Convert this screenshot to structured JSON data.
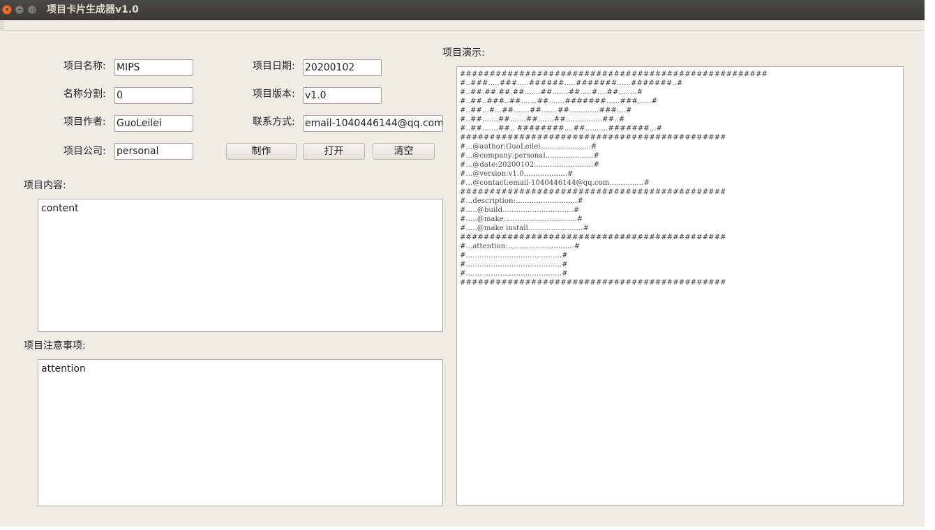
{
  "window": {
    "title": "项目卡片生成器v1.0",
    "controls": {
      "close": "×",
      "minimize": "–",
      "maximize": "▫"
    }
  },
  "form": {
    "name_label": "项目名称:",
    "name_value": "MIPS",
    "date_label": "项目日期:",
    "date_value": "20200102",
    "split_label": "名称分割:",
    "split_value": "0",
    "version_label": "项目版本:",
    "version_value": "v1.0",
    "author_label": "项目作者:",
    "author_value": "GuoLeilei",
    "contact_label": "联系方式:",
    "contact_value": "email-1040446144@qq.com",
    "company_label": "项目公司:",
    "company_value": "personal",
    "make_button": "制作",
    "open_button": "打开",
    "clear_button": "清空",
    "content_label": "项目内容:",
    "content_value": "content",
    "attention_label": "项目注意事项:",
    "attention_value": "attention"
  },
  "preview": {
    "label": "项目演示:",
    "text": "####################################################\n#..###.....###.....######.....#######......#######..#\n#..##.##.##.##.......##.......##.....#....##........#\n#..##..###..##.......##.......#######......###......#\n#..##...#...##.......##.......##.............###....#\n#..##.......##.......##.......##................##..#\n#..##.......##.. ########....##..........#######...#\n#############################################\n#...@author:GuoLeilei......................#\n#...@company:personal.....................#\n#...@date:20200102..........................#\n#...@version:v1.0...................#\n#...@contact:email-1040446144@qq.com...............#\n#############################################\n#...description:...........................#\n#.....@build...............................#\n#.....@make................................#\n#.....@make install........................#\n#############################################\n#...attention:.............................#\n#..........................................#\n#..........................................#\n#..........................................#\n#############################################"
  }
}
